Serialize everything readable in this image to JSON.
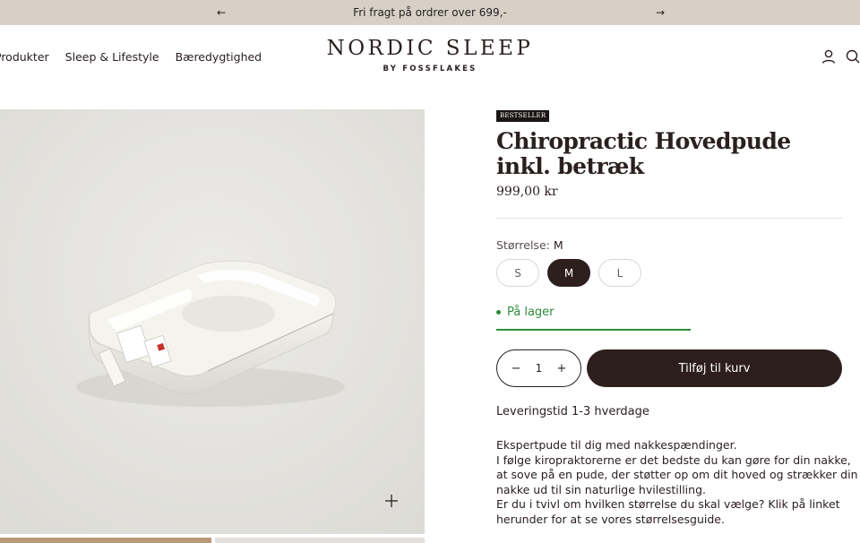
{
  "announcement": {
    "message": "Fri fragt på ordrer over 699,-",
    "prev_icon": "←",
    "next_icon": "→"
  },
  "header": {
    "nav": [
      "Produkter",
      "Sleep & Lifestyle",
      "Bæredygtighed"
    ],
    "logo_main": "NORDIC SLEEP",
    "logo_sub": "BY FOSSFLAKES",
    "icons": [
      "account-icon",
      "search-icon"
    ]
  },
  "product": {
    "badge": "BESTSELLER",
    "title": "Chiropractic Hovedpude inkl. betræk",
    "price": "999,00 kr",
    "size_label": "Størrelse:",
    "size_selected": "M",
    "sizes": [
      "S",
      "M",
      "L"
    ],
    "stock": "På lager",
    "quantity": "1",
    "qty_minus": "−",
    "qty_plus": "+",
    "add_to_cart": "Tilføj til kurv",
    "delivery": "Leveringstid 1-3 hverdage",
    "description": [
      "Ekspertpude til dig med nakkespændinger.",
      "I følge kiropraktorerne er det bedste du kan gøre for din nakke,",
      "at sove på en pude, der støtter op om dit hoved og strækker din",
      "nakke ud til sin naturlige hvilestilling.",
      "Er du i tvivl om hvilken størrelse du skal vælge? Klik på linket",
      "herunder for at se vores størrelsesguide."
    ]
  },
  "colors": {
    "announcement_bg": "#d8cfc6",
    "primary": "#2e1f1f",
    "stock_green": "#2e8b3a"
  }
}
